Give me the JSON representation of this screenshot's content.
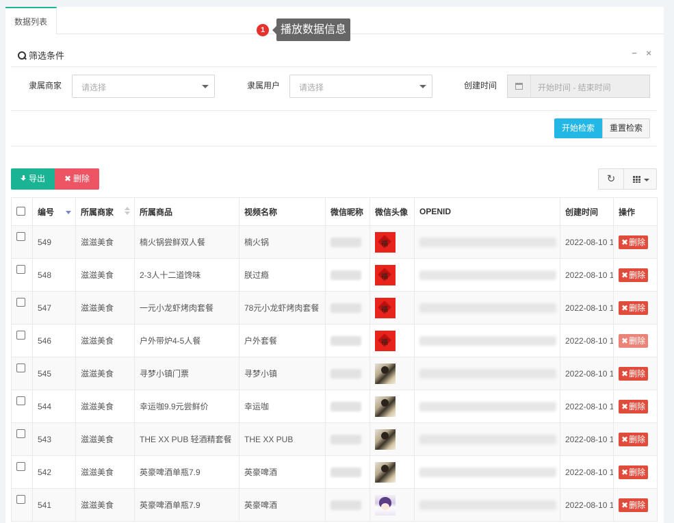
{
  "tabs": [
    {
      "label": "数据列表"
    }
  ],
  "tooltip": {
    "badge": "1",
    "text": "播放数据信息"
  },
  "filter": {
    "title": "筛选条件",
    "tools": {
      "collapse": "−",
      "close": "×"
    },
    "merchant_label": "隶属商家",
    "merchant_placeholder": "请选择",
    "user_label": "隶属用户",
    "user_placeholder": "请选择",
    "time_label": "创建时间",
    "time_placeholder": "开始时间 - 结束时间",
    "search_label": "开始检索",
    "reset_label": "重置检索"
  },
  "toolbar": {
    "export_label": "导出",
    "delete_label": "删除"
  },
  "table": {
    "columns": [
      "编号",
      "所属商家",
      "所属商品",
      "视频名称",
      "微信昵称",
      "微信头像",
      "OPENID",
      "创建时间",
      "操作"
    ],
    "delete_label": "删除",
    "rows": [
      {
        "id": "549",
        "merchant": "滋滋美食",
        "product": "楠火锅尝鲜双人餐",
        "video": "楠火锅",
        "avatar": "fu-icon",
        "created": "2022-08-10 1"
      },
      {
        "id": "548",
        "merchant": "滋滋美食",
        "product": "2-3人十二道馋味",
        "video": "朕过瘾",
        "avatar": "fu-icon",
        "created": "2022-08-10 1"
      },
      {
        "id": "547",
        "merchant": "滋滋美食",
        "product": "一元小龙虾烤肉套餐",
        "video": "78元小龙虾烤肉套餐",
        "avatar": "fu-icon",
        "created": "2022-08-10 1"
      },
      {
        "id": "546",
        "merchant": "滋滋美食",
        "product": "户外带炉4-5人餐",
        "video": "户外套餐",
        "avatar": "fu-icon",
        "created": "2022-08-10 1"
      },
      {
        "id": "545",
        "merchant": "滋滋美食",
        "product": "寻梦小镇门票",
        "video": "寻梦小镇",
        "avatar": "photo-avatar",
        "created": "2022-08-10 1"
      },
      {
        "id": "544",
        "merchant": "滋滋美食",
        "product": "幸运咖9.9元尝鲜价",
        "video": "幸运咖",
        "avatar": "photo-avatar",
        "created": "2022-08-10 1"
      },
      {
        "id": "543",
        "merchant": "滋滋美食",
        "product": "THE XX PUB 轻酒精套餐",
        "video": "THE XX PUB",
        "avatar": "photo-avatar",
        "created": "2022-08-10 1"
      },
      {
        "id": "542",
        "merchant": "滋滋美食",
        "product": "英豪啤酒单瓶7.9",
        "video": "英豪啤酒",
        "avatar": "photo-avatar",
        "created": "2022-08-10 1"
      },
      {
        "id": "541",
        "merchant": "滋滋美食",
        "product": "英豪啤酒单瓶7.9",
        "video": "英豪啤酒",
        "avatar": "anime-avatar",
        "created": "2022-08-10 1"
      }
    ]
  },
  "colors": {
    "accent": "#1ab394",
    "info": "#23b7e5",
    "danger": "#ed5565",
    "row_delete": "#e04b3c"
  }
}
